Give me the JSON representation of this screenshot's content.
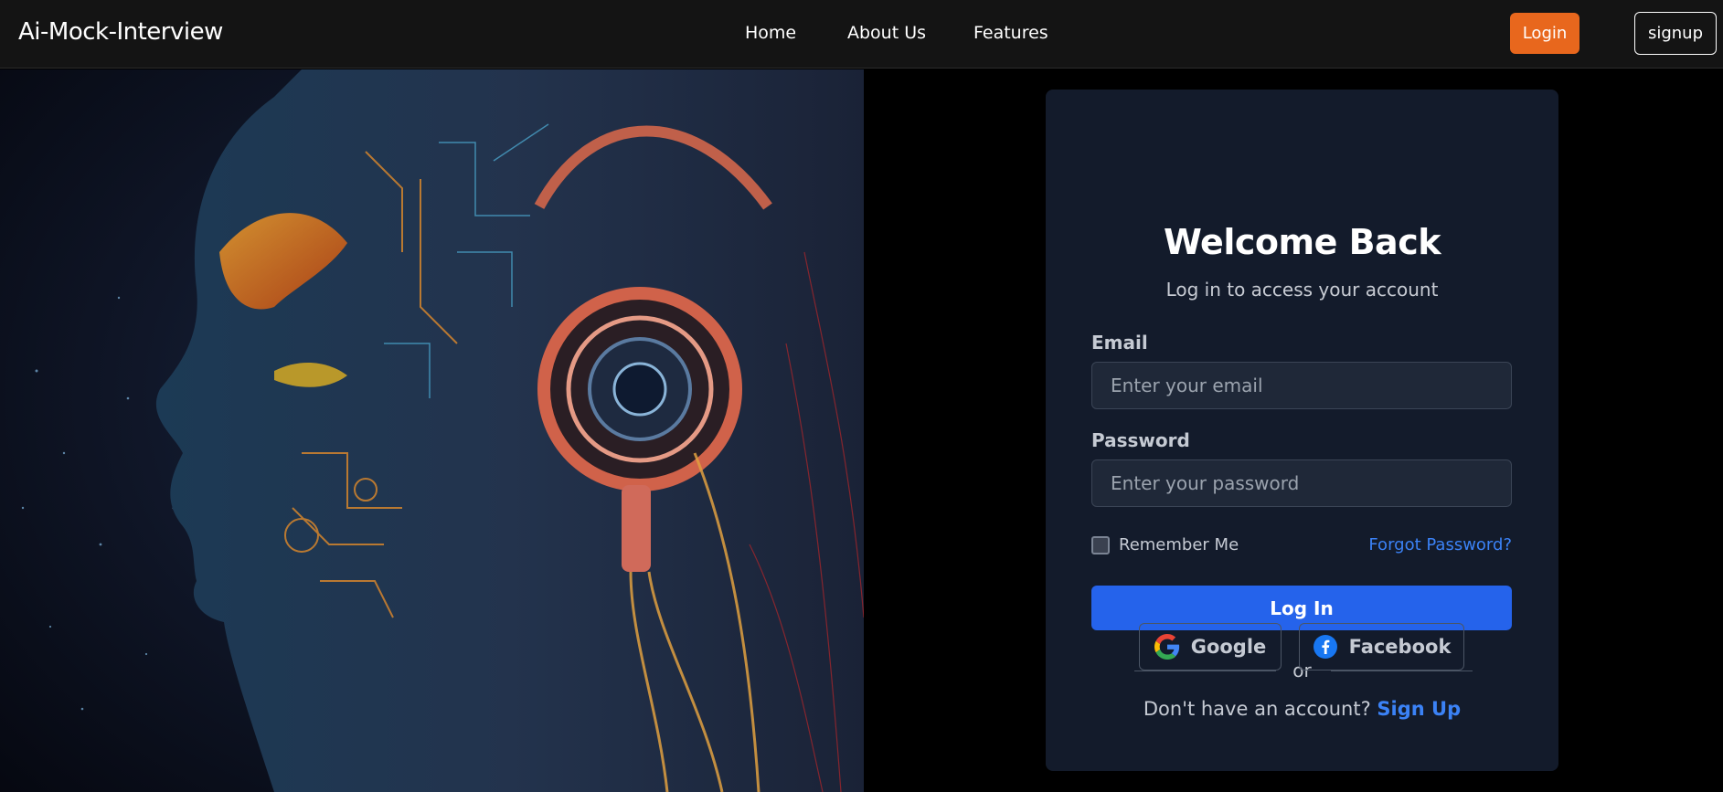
{
  "nav": {
    "brand": "Ai-Mock-Interview",
    "links": [
      "Home",
      "About Us",
      "Features"
    ],
    "login_label": "Login",
    "signup_label": "signup"
  },
  "login": {
    "title": "Welcome Back",
    "subtitle": "Log in to access your account",
    "email_label": "Email",
    "email_placeholder": "Enter your email",
    "password_label": "Password",
    "password_placeholder": "Enter your password",
    "remember_label": "Remember Me",
    "forgot_label": "Forgot Password?",
    "submit_label": "Log In",
    "divider": "or",
    "google_label": "Google",
    "facebook_label": "Facebook",
    "signup_prompt": "Don't have an account?",
    "signup_link": "Sign Up"
  },
  "colors": {
    "accent": "#e8671d",
    "primary": "#2563eb",
    "link": "#3b82f6",
    "card": "#131b2b"
  },
  "icons": {
    "google": "google-icon",
    "facebook": "facebook-icon"
  }
}
